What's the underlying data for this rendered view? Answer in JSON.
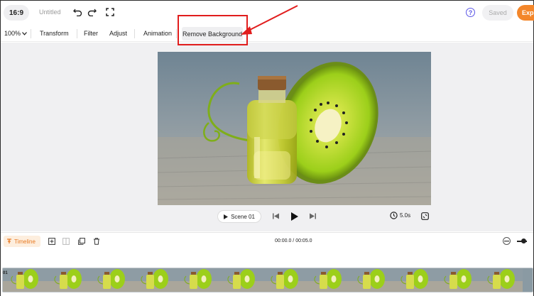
{
  "topbar": {
    "aspect_ratio": "16:9",
    "title": "Untitled",
    "saved_label": "Saved",
    "export_label": "Exp",
    "help_symbol": "?",
    "icons": [
      "undo-icon",
      "redo-icon",
      "fullscreen-icon",
      "help-icon"
    ]
  },
  "toolbar": {
    "zoom": "100%",
    "tools": [
      "Transform",
      "Filter",
      "Adjust",
      "Animation"
    ],
    "remove_background": "Remove Background"
  },
  "player": {
    "scene_label": "Scene  01",
    "duration": "5.0s",
    "icons": [
      "play-icon",
      "skip-back-icon",
      "play-icon",
      "skip-forward-icon",
      "clock-icon",
      "fit-screen-icon"
    ]
  },
  "timeline": {
    "label": "Timeline",
    "time_readout": "00:00.0 / 00:05.0",
    "clip_label": "01",
    "thumbnail_count": 12,
    "icons": [
      "timeline-icon",
      "add-icon",
      "split-icon",
      "duplicate-icon",
      "delete-icon",
      "zoom-out-icon",
      "zoom-slider"
    ]
  },
  "colors": {
    "accent_orange": "#f3862a",
    "help_purple": "#5b56e6",
    "annotation_red": "#e11d1d"
  }
}
